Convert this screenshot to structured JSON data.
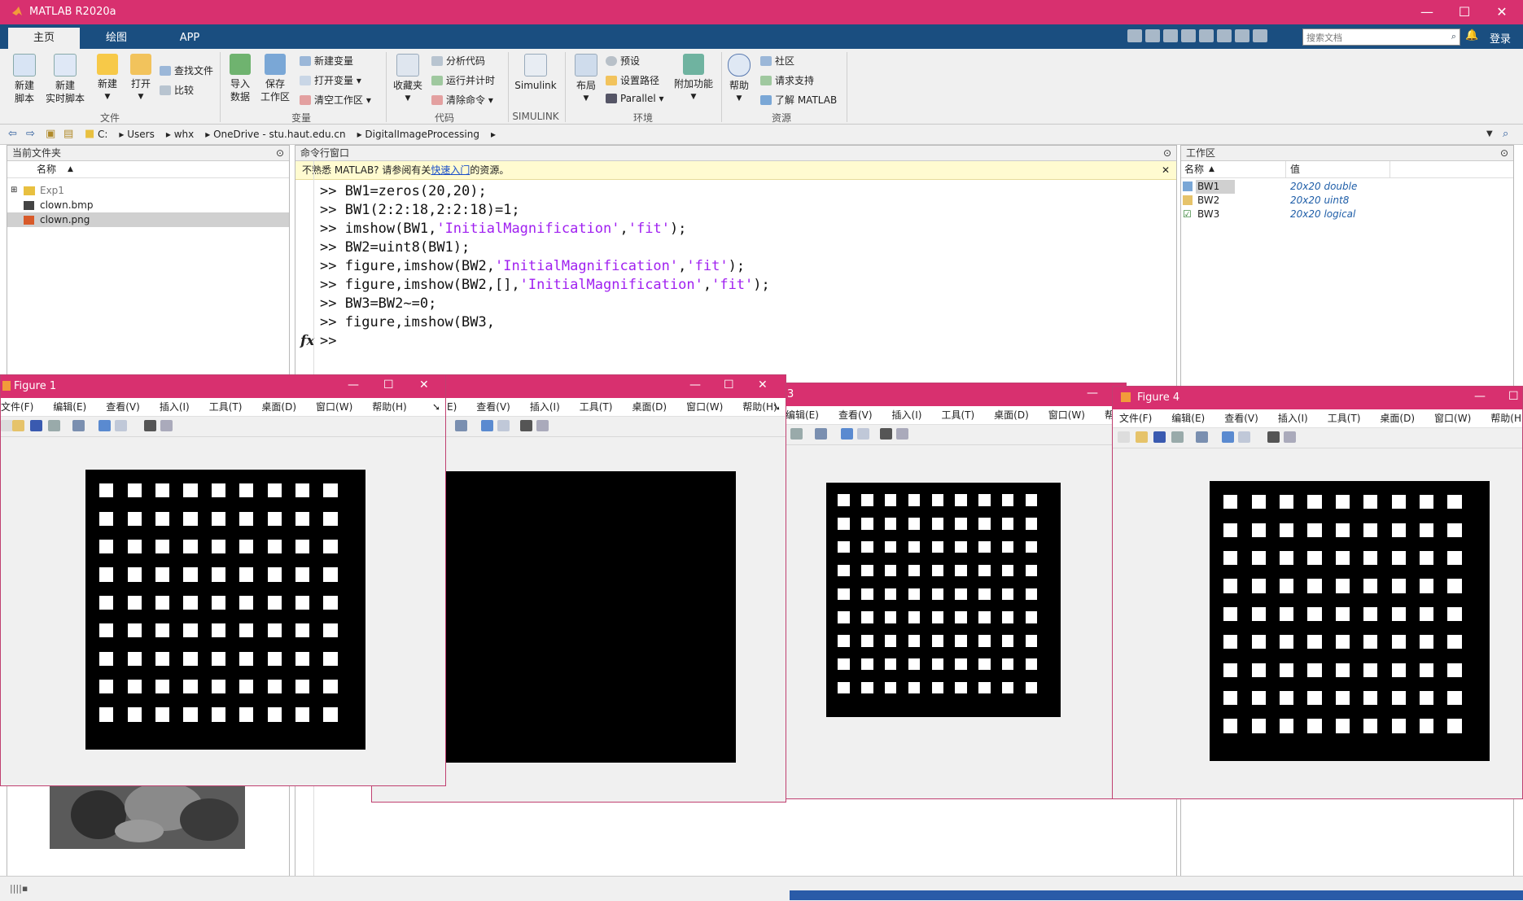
{
  "app": {
    "title": "MATLAB R2020a"
  },
  "tabs": [
    "主页",
    "绘图",
    "APP"
  ],
  "search": {
    "placeholder": "搜索文档"
  },
  "header": {
    "login": "登录"
  },
  "ribbon": {
    "file": {
      "new_script": "新建\n脚本",
      "new_live_script": "新建\n实时脚本",
      "new": "新建",
      "open": "打开",
      "find_files": "查找文件",
      "compare": "比较",
      "group": "文件"
    },
    "variable": {
      "import_data": "导入\n数据",
      "save_workspace": "保存\n工作区",
      "new_variable": "新建变量",
      "open_variable": "打开变量",
      "clear_workspace": "清空工作区",
      "group": "变量"
    },
    "code": {
      "favorites": "收藏夹",
      "analyze_code": "分析代码",
      "run_and_time": "运行并计时",
      "clear_commands": "清除命令",
      "group": "代码"
    },
    "simulink": {
      "label": "Simulink",
      "group": "SIMULINK"
    },
    "environment": {
      "layout": "布局",
      "preferences": "预设",
      "set_path": "设置路径",
      "parallel": "Parallel",
      "addons": "附加功能",
      "group": "环境"
    },
    "resources": {
      "help": "帮助",
      "community": "社区",
      "request_support": "请求支持",
      "learn_matlab": "了解 MATLAB",
      "group": "资源"
    }
  },
  "address": {
    "crumbs": [
      "C:",
      "Users",
      "whx",
      "OneDrive - stu.haut.edu.cn",
      "DigitalImageProcessing"
    ]
  },
  "current_folder": {
    "title": "当前文件夹",
    "column": "名称",
    "items": [
      {
        "name": "Exp1",
        "type": "folder"
      },
      {
        "name": "clown.bmp",
        "type": "file"
      },
      {
        "name": "clown.png",
        "type": "file",
        "selected": true
      }
    ]
  },
  "command_window": {
    "title": "命令行窗口",
    "notice_prefix": "不熟悉 MATLAB? 请参阅有关",
    "notice_link": "快速入门",
    "notice_suffix": "的资源。",
    "prompt": ">>",
    "fx": "fx",
    "lines": [
      {
        "a": "BW1=zeros(20,20);"
      },
      {
        "a": "BW1(2:2:18,2:2:18)=1;"
      },
      {
        "a": "imshow(BW1,",
        "s1": "'InitialMagnification'",
        "b": ",",
        "s2": "'fit'",
        "c": ");"
      },
      {
        "a": "BW2=uint8(BW1);"
      },
      {
        "a": "figure,imshow(BW2,",
        "s1": "'InitialMagnification'",
        "b": ",",
        "s2": "'fit'",
        "c": ");"
      },
      {
        "a": "figure,imshow(BW2,[],",
        "s1": "'InitialMagnification'",
        "b": ",",
        "s2": "'fit'",
        "c": ");"
      },
      {
        "a": "BW3=BW2~=0;"
      },
      {
        "a": "figure,imshow(BW3,",
        "s1": "'InitialMagnification'",
        "b": ",",
        "s2": "'fit'",
        "c": ");"
      }
    ]
  },
  "workspace": {
    "title": "工作区",
    "col_name": "名称",
    "col_value": "值",
    "vars": [
      {
        "name": "BW1",
        "value": "20x20 double"
      },
      {
        "name": "BW2",
        "value": "20x20 uint8"
      },
      {
        "name": "BW3",
        "value": "20x20 logical"
      }
    ]
  },
  "figures": {
    "fig1_title": "Figure 1",
    "fig3_title": "3",
    "fig4_title": "Figure 4",
    "menu_full": [
      "文件(F)",
      "编辑(E)",
      "查看(V)",
      "插入(I)",
      "工具(T)",
      "桌面(D)",
      "窗口(W)",
      "帮助(H)"
    ],
    "menu_fig1": [
      "文件(F)",
      "编辑(E)",
      "查看(V)",
      "插入(I)",
      "工具(T)",
      "桌面(D)",
      "窗口(W)",
      "帮助(H)"
    ],
    "menu_fig2": [
      "E)",
      "查看(V)",
      "插入(I)",
      "工具(T)",
      "桌面(D)",
      "窗口(W)",
      "帮助(H)"
    ],
    "menu_fig3": [
      "编辑(E)",
      "查看(V)",
      "插入(I)",
      "工具(T)",
      "桌面(D)",
      "窗口(W)",
      "帮助(H)"
    ],
    "grid": {
      "cells": 20,
      "dot_rows": 9,
      "dot_cols": 9
    }
  },
  "colors": {
    "titlebar": "#d8306f",
    "tabstrip": "#1a4e80",
    "string": "#a020f0",
    "ws_value": "#1f5ea8"
  }
}
